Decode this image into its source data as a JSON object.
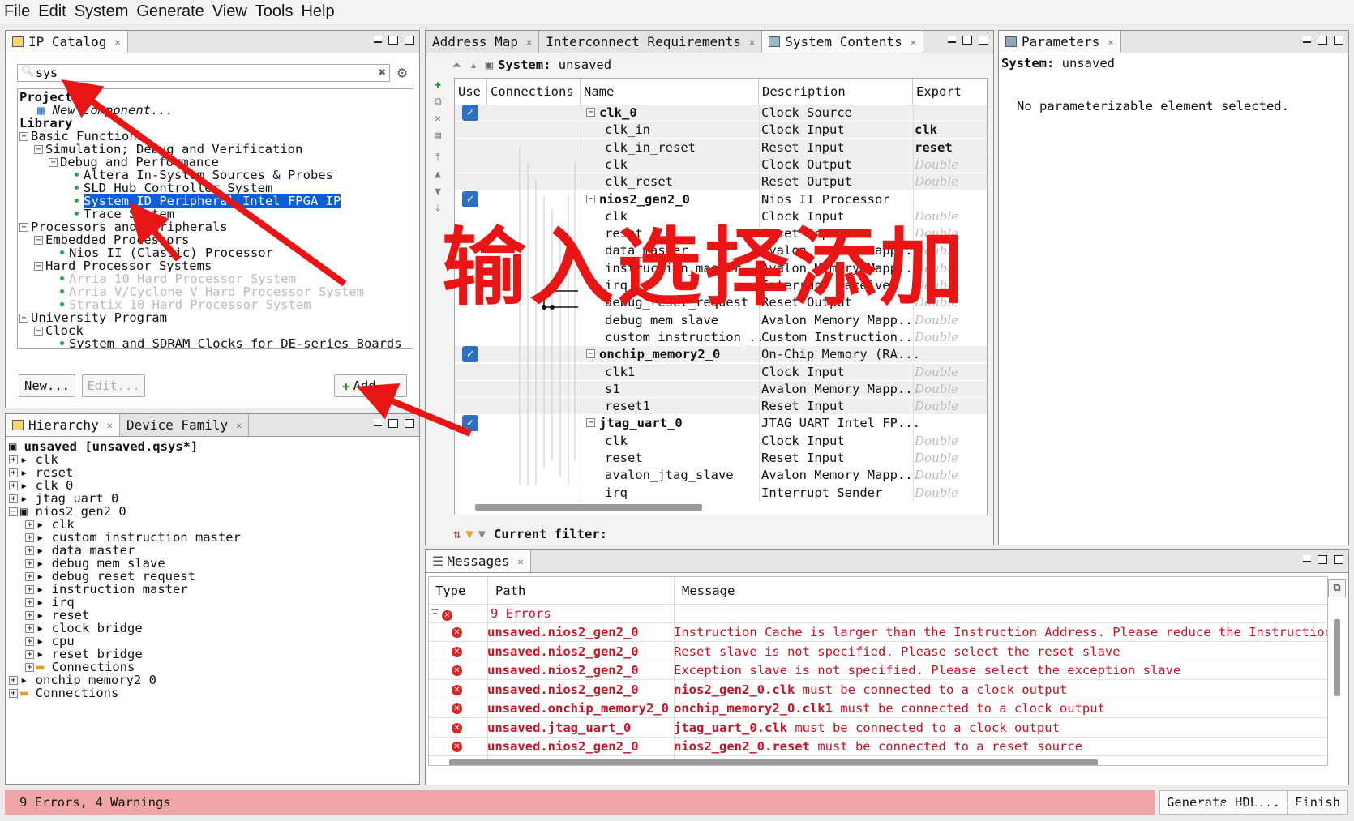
{
  "menubar": {
    "items": [
      "File",
      "Edit",
      "System",
      "Generate",
      "View",
      "Tools",
      "Help"
    ]
  },
  "ip_catalog": {
    "tab_label": "IP Catalog",
    "search_value": "sys",
    "tree": [
      {
        "text": "Project",
        "indent": 0,
        "kind": "head"
      },
      {
        "text": "New Component...",
        "indent": 1,
        "kind": "new"
      },
      {
        "text": "Library",
        "indent": 0,
        "kind": "head"
      },
      {
        "text": "Basic Functions",
        "indent": 0,
        "kind": "node"
      },
      {
        "text": "Simulation; Debug and Verification",
        "indent": 1,
        "kind": "node"
      },
      {
        "text": "Debug and Performance",
        "indent": 2,
        "kind": "node"
      },
      {
        "text": "Altera In-System Sources & Probes",
        "indent": 3,
        "kind": "leaf"
      },
      {
        "text": "SLD Hub Controller System",
        "indent": 3,
        "kind": "leaf"
      },
      {
        "text": "System ID Peripheral Intel FPGA IP",
        "indent": 3,
        "kind": "leaf",
        "selected": true
      },
      {
        "text": "Trace System",
        "indent": 3,
        "kind": "leaf"
      },
      {
        "text": "Processors and Peripherals",
        "indent": 0,
        "kind": "node"
      },
      {
        "text": "Embedded Processors",
        "indent": 1,
        "kind": "node"
      },
      {
        "text": "Nios II (Classic) Processor",
        "indent": 2,
        "kind": "leaf"
      },
      {
        "text": "Hard Processor Systems",
        "indent": 1,
        "kind": "node"
      },
      {
        "text": "Arria 10 Hard Processor System",
        "indent": 2,
        "kind": "leaf",
        "disabled": true
      },
      {
        "text": "Arria V/Cyclone V Hard Processor System",
        "indent": 2,
        "kind": "leaf",
        "disabled": true
      },
      {
        "text": "Stratix 10 Hard Processor System",
        "indent": 2,
        "kind": "leaf",
        "disabled": true
      },
      {
        "text": "University Program",
        "indent": 0,
        "kind": "node"
      },
      {
        "text": "Clock",
        "indent": 1,
        "kind": "node"
      },
      {
        "text": "System and SDRAM Clocks for DE-series Boards",
        "indent": 2,
        "kind": "leaf"
      }
    ],
    "new_button": "New...",
    "edit_button": "Edit...",
    "add_button": "Add..."
  },
  "hierarchy": {
    "tab_label": "Hierarchy",
    "tab2_label": "Device Family",
    "items": [
      {
        "text": "unsaved [unsaved.qsys*]",
        "indent": 0,
        "bold": true
      },
      {
        "text": "clk",
        "indent": 0
      },
      {
        "text": "reset",
        "indent": 0
      },
      {
        "text": "clk 0",
        "indent": 0
      },
      {
        "text": "jtag uart 0",
        "indent": 0
      },
      {
        "text": "nios2 gen2 0",
        "indent": 0
      },
      {
        "text": "clk",
        "indent": 1
      },
      {
        "text": "custom instruction master",
        "indent": 1
      },
      {
        "text": "data master",
        "indent": 1
      },
      {
        "text": "debug mem slave",
        "indent": 1
      },
      {
        "text": "debug reset request",
        "indent": 1
      },
      {
        "text": "instruction master",
        "indent": 1
      },
      {
        "text": "irq",
        "indent": 1
      },
      {
        "text": "reset",
        "indent": 1
      },
      {
        "text": "clock bridge",
        "indent": 1
      },
      {
        "text": "cpu",
        "indent": 1
      },
      {
        "text": "reset bridge",
        "indent": 1
      },
      {
        "text": "Connections",
        "indent": 1,
        "folder": true
      },
      {
        "text": "onchip memory2 0",
        "indent": 0
      },
      {
        "text": "Connections",
        "indent": 0,
        "folder": true
      }
    ]
  },
  "tabs_center": {
    "address_map": "Address Map",
    "interconnect": "Interconnect Requirements",
    "system_contents": "System Contents"
  },
  "system_contents": {
    "system_label": "System:",
    "system_value": "unsaved",
    "columns": [
      "Use",
      "Connections",
      "Name",
      "Description",
      "Export"
    ],
    "rows": [
      {
        "name": "clk_0",
        "desc": "Clock Source",
        "export": "",
        "group": true,
        "checked": true
      },
      {
        "name": "clk_in",
        "desc": "Clock Input",
        "export": "clk"
      },
      {
        "name": "clk_in_reset",
        "desc": "Reset Input",
        "export": "reset"
      },
      {
        "name": "clk",
        "desc": "Clock Output",
        "export": "Double"
      },
      {
        "name": "clk_reset",
        "desc": "Reset Output",
        "export": "Double"
      },
      {
        "name": "nios2_gen2_0",
        "desc": "Nios II Processor",
        "export": "",
        "group": true,
        "checked": true
      },
      {
        "name": "clk",
        "desc": "Clock Input",
        "export": "Double"
      },
      {
        "name": "reset",
        "desc": "Reset Input",
        "export": "Double"
      },
      {
        "name": "data_master",
        "desc": "Avalon Memory Mapp...",
        "export": "Double"
      },
      {
        "name": "instruction_master",
        "desc": "Avalon Memory Mapp...",
        "export": "Double"
      },
      {
        "name": "irq",
        "desc": "Interrupt Receiver",
        "export": "Double"
      },
      {
        "name": "debug_reset_request",
        "desc": "Reset Output",
        "export": "Double"
      },
      {
        "name": "debug_mem_slave",
        "desc": "Avalon Memory Mapp...",
        "export": "Double"
      },
      {
        "name": "custom_instruction_...",
        "desc": "Custom Instruction...",
        "export": "Double"
      },
      {
        "name": "onchip_memory2_0",
        "desc": "On-Chip Memory (RA...",
        "export": "",
        "group": true,
        "checked": true
      },
      {
        "name": "clk1",
        "desc": "Clock Input",
        "export": "Double"
      },
      {
        "name": "s1",
        "desc": "Avalon Memory Mapp...",
        "export": "Double"
      },
      {
        "name": "reset1",
        "desc": "Reset Input",
        "export": "Double"
      },
      {
        "name": "jtag_uart_0",
        "desc": "JTAG UART Intel FP...",
        "export": "",
        "group": true,
        "checked": true
      },
      {
        "name": "clk",
        "desc": "Clock Input",
        "export": "Double"
      },
      {
        "name": "reset",
        "desc": "Reset Input",
        "export": "Double"
      },
      {
        "name": "avalon_jtag_slave",
        "desc": "Avalon Memory Mapp...",
        "export": "Double"
      },
      {
        "name": "irq",
        "desc": "Interrupt Sender",
        "export": "Double"
      }
    ],
    "filter_label": "Current filter:"
  },
  "parameters": {
    "tab_label": "Parameters",
    "system_label": "System:",
    "system_value": "unsaved",
    "message": "No parameterizable element selected."
  },
  "messages": {
    "tab_label": "Messages",
    "columns": [
      "Type",
      "Path",
      "Message"
    ],
    "summary": "9 Errors",
    "rows": [
      {
        "path": "unsaved.nios2_gen2_0",
        "msg": "Instruction Cache is larger than the Instruction Address. Please reduce the Instruction",
        "bold": ""
      },
      {
        "path": "unsaved.nios2_gen2_0",
        "msg": "Reset slave is not specified. Please select the reset slave",
        "bold": ""
      },
      {
        "path": "unsaved.nios2_gen2_0",
        "msg": "Exception slave is not specified. Please select the exception slave",
        "bold": ""
      },
      {
        "path": "unsaved.nios2_gen2_0",
        "bold": "nios2_gen2_0.clk",
        "msg": " must be connected to a clock output"
      },
      {
        "path": "unsaved.onchip_memory2_0",
        "bold": "onchip_memory2_0.clk1",
        "msg": " must be connected to a clock output"
      },
      {
        "path": "unsaved.jtag_uart_0",
        "bold": "jtag_uart_0.clk",
        "msg": " must be connected to a clock output"
      },
      {
        "path": "unsaved.nios2_gen2_0",
        "bold": "nios2_gen2_0.reset",
        "msg": " must be connected to a reset source"
      }
    ]
  },
  "status": {
    "text": "9 Errors, 4 Warnings",
    "generate_button": "Generate HDL...",
    "finish_button": "Finish"
  },
  "annotation": {
    "text": "输入选择添加",
    "color": "#e81515"
  },
  "watermark": "CSDN @LX很爱吃葱"
}
